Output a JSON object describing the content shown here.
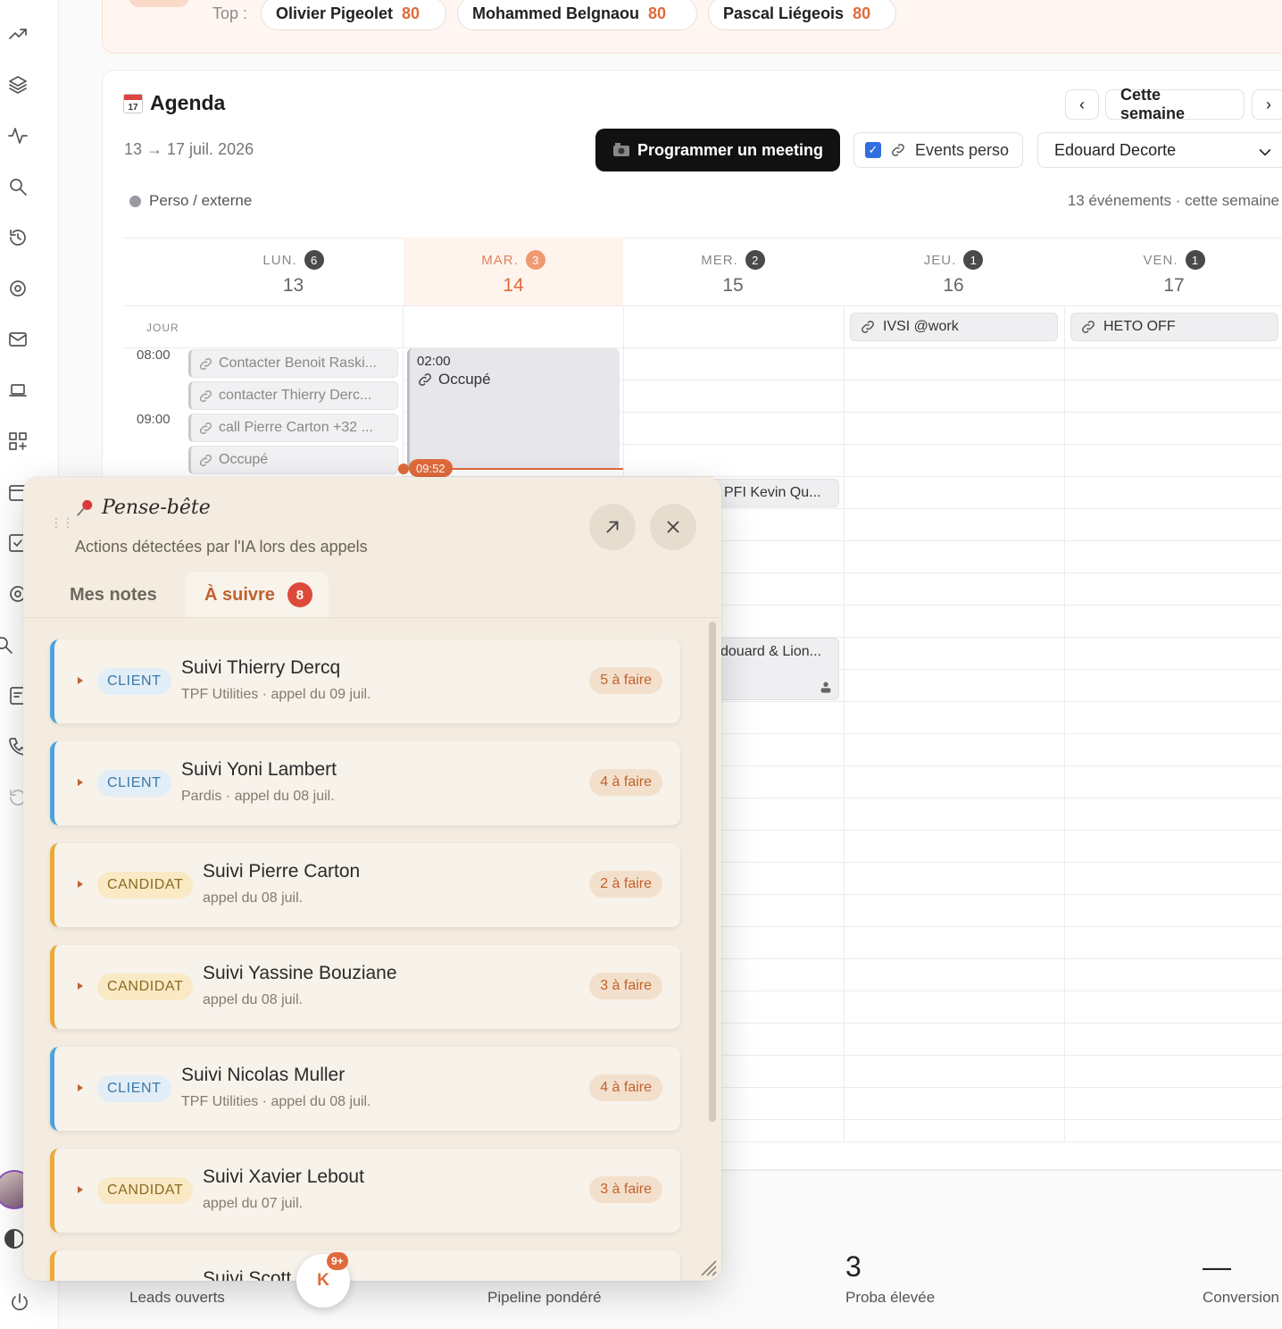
{
  "top_bar": {
    "label": "Top :",
    "leaders": [
      {
        "name": "Olivier Pigeolet",
        "score": "80"
      },
      {
        "name": "Mohammed Belgnaou",
        "score": "80"
      },
      {
        "name": "Pascal Liégeois",
        "score": "80"
      }
    ]
  },
  "agenda": {
    "title": "Agenda",
    "calendar_emoji_day": "17",
    "date_range": "13 → 17 juil. 2026",
    "week_button": "Cette semaine",
    "prev": "‹",
    "next": "›",
    "meeting_button": "Programmer un meeting",
    "events_toggle": "Events perso",
    "events_checked": "✓",
    "user_select": "Edouard Decorte",
    "legend": "Perso / externe",
    "events_count": "13 événements · cette semaine",
    "allday_label": "JOUR",
    "times": [
      "08:00",
      "09:00"
    ],
    "days": [
      {
        "name": "LUN.",
        "count": "6",
        "num": "13"
      },
      {
        "name": "MAR.",
        "count": "3",
        "num": "14"
      },
      {
        "name": "MER.",
        "count": "2",
        "num": "15"
      },
      {
        "name": "JEU.",
        "count": "1",
        "num": "16"
      },
      {
        "name": "VEN.",
        "count": "1",
        "num": "17"
      }
    ],
    "allday_events": [
      "IVSI @work",
      "HETO OFF"
    ],
    "monday_events": [
      "Contacter Benoit Raski...",
      "contacter Thierry Derc...",
      "call Pierre Carton +32 ...",
      "Occupé"
    ],
    "occupied": {
      "time": "02:00",
      "label": "Occupé"
    },
    "now_time": "09:52",
    "partial_events": [
      "PFI Kevin Qu...",
      "douard & Lion..."
    ]
  },
  "stats": [
    {
      "value": "",
      "label": "Leads ouverts"
    },
    {
      "value": "",
      "label": "Pipeline pondéré"
    },
    {
      "value": "3",
      "label": "Proba élevée"
    },
    {
      "value": "—",
      "label": "Conversion"
    }
  ],
  "panel": {
    "title": "Pense-bête",
    "subtitle": "Actions détectées par l'IA lors des appels",
    "tabs": {
      "notes": "Mes notes",
      "follow": "À suivre",
      "follow_count": "8"
    },
    "cards": [
      {
        "tag": "CLIENT",
        "title": "Suivi Thierry Dercq",
        "sub": "TPF Utilities · appel du 09 juil.",
        "todo": "5 à faire"
      },
      {
        "tag": "CLIENT",
        "title": "Suivi Yoni Lambert",
        "sub": "Pardis · appel du 08 juil.",
        "todo": "4 à faire"
      },
      {
        "tag": "CANDIDAT",
        "title": "Suivi Pierre Carton",
        "sub": "appel du 08 juil.",
        "todo": "2 à faire"
      },
      {
        "tag": "CANDIDAT",
        "title": "Suivi Yassine Bouziane",
        "sub": "appel du 08 juil.",
        "todo": "3 à faire"
      },
      {
        "tag": "CLIENT",
        "title": "Suivi Nicolas Muller",
        "sub": "TPF Utilities · appel du 08 juil.",
        "todo": "4 à faire"
      },
      {
        "tag": "CANDIDAT",
        "title": "Suivi Xavier Lebout",
        "sub": "appel du 07 juil.",
        "todo": "3 à faire"
      },
      {
        "tag": "",
        "title": "Suivi Scott",
        "sub": "",
        "todo": ""
      }
    ]
  },
  "fab": {
    "letter": "K",
    "badge": "9+"
  }
}
